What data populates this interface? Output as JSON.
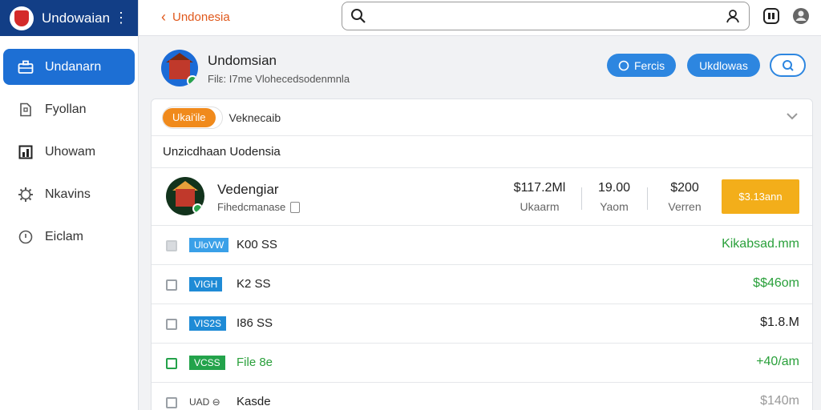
{
  "app": {
    "brand_name": "Undowaian",
    "menu_icon": "more-vertical-icon"
  },
  "sidebar": {
    "items": [
      {
        "label": "Undanarn",
        "icon": "briefcase-icon",
        "active": true
      },
      {
        "label": "Fyollan",
        "icon": "document-icon",
        "active": false
      },
      {
        "label": "Uhowam",
        "icon": "chart-icon",
        "active": false
      },
      {
        "label": "Nkavins",
        "icon": "gear-icon",
        "active": false
      },
      {
        "label": "Eiclam",
        "icon": "chat-icon",
        "active": false
      }
    ]
  },
  "topbar": {
    "back_label": "Undonesia",
    "search": {
      "value": "",
      "placeholder": ""
    }
  },
  "header": {
    "title": "Undomsian",
    "subtitle": "Filε: I7me Vlohecedsodenmnla",
    "buttons": {
      "primary_1": "Fercis",
      "primary_2": "Ukdlowas"
    }
  },
  "card": {
    "tag_label": "Ukaiʹile",
    "tag_text": "Veknecaib",
    "section_title": "Unzicdhaan Uodensia",
    "feature": {
      "name": "Vedengiar",
      "sub": "Fihedcmanase",
      "stats": [
        {
          "value": "$117.2Ml",
          "label": "Ukaarm"
        },
        {
          "value": "19.00",
          "label": "Yaom"
        },
        {
          "value": "$200",
          "label": "Verren"
        }
      ],
      "cta_label": "$3.13ann"
    },
    "rows": [
      {
        "chip": "UloVW",
        "chip_color": "#3aa0e8",
        "name": "K00 SS",
        "amount": "Kikabsad.mm",
        "amount_style": "green",
        "check": "grey-light"
      },
      {
        "chip": "VIGH",
        "chip_color": "#1f8bd6",
        "name": "K2 SS",
        "amount": "$$46om",
        "amount_style": "green",
        "check": "grey"
      },
      {
        "chip": "VIS2S",
        "chip_color": "#1f8bd6",
        "name": "I86 SS",
        "amount": "$1.8.M",
        "amount_style": "normal",
        "check": "grey"
      },
      {
        "chip": "VCSS",
        "chip_color": "#23a34b",
        "name": "File 8e",
        "amount": "+40/am",
        "amount_style": "green",
        "check": "green"
      },
      {
        "chip": "UAD ⊖",
        "chip_color": "",
        "name": "Kasde",
        "amount": "$140m",
        "amount_style": "grey",
        "check": "grey"
      }
    ]
  },
  "colors": {
    "brand": "#123e86",
    "accent": "#1d6fd4",
    "orange": "#f08a1c",
    "cta": "#f3ae1a",
    "green": "#2aa03b"
  }
}
